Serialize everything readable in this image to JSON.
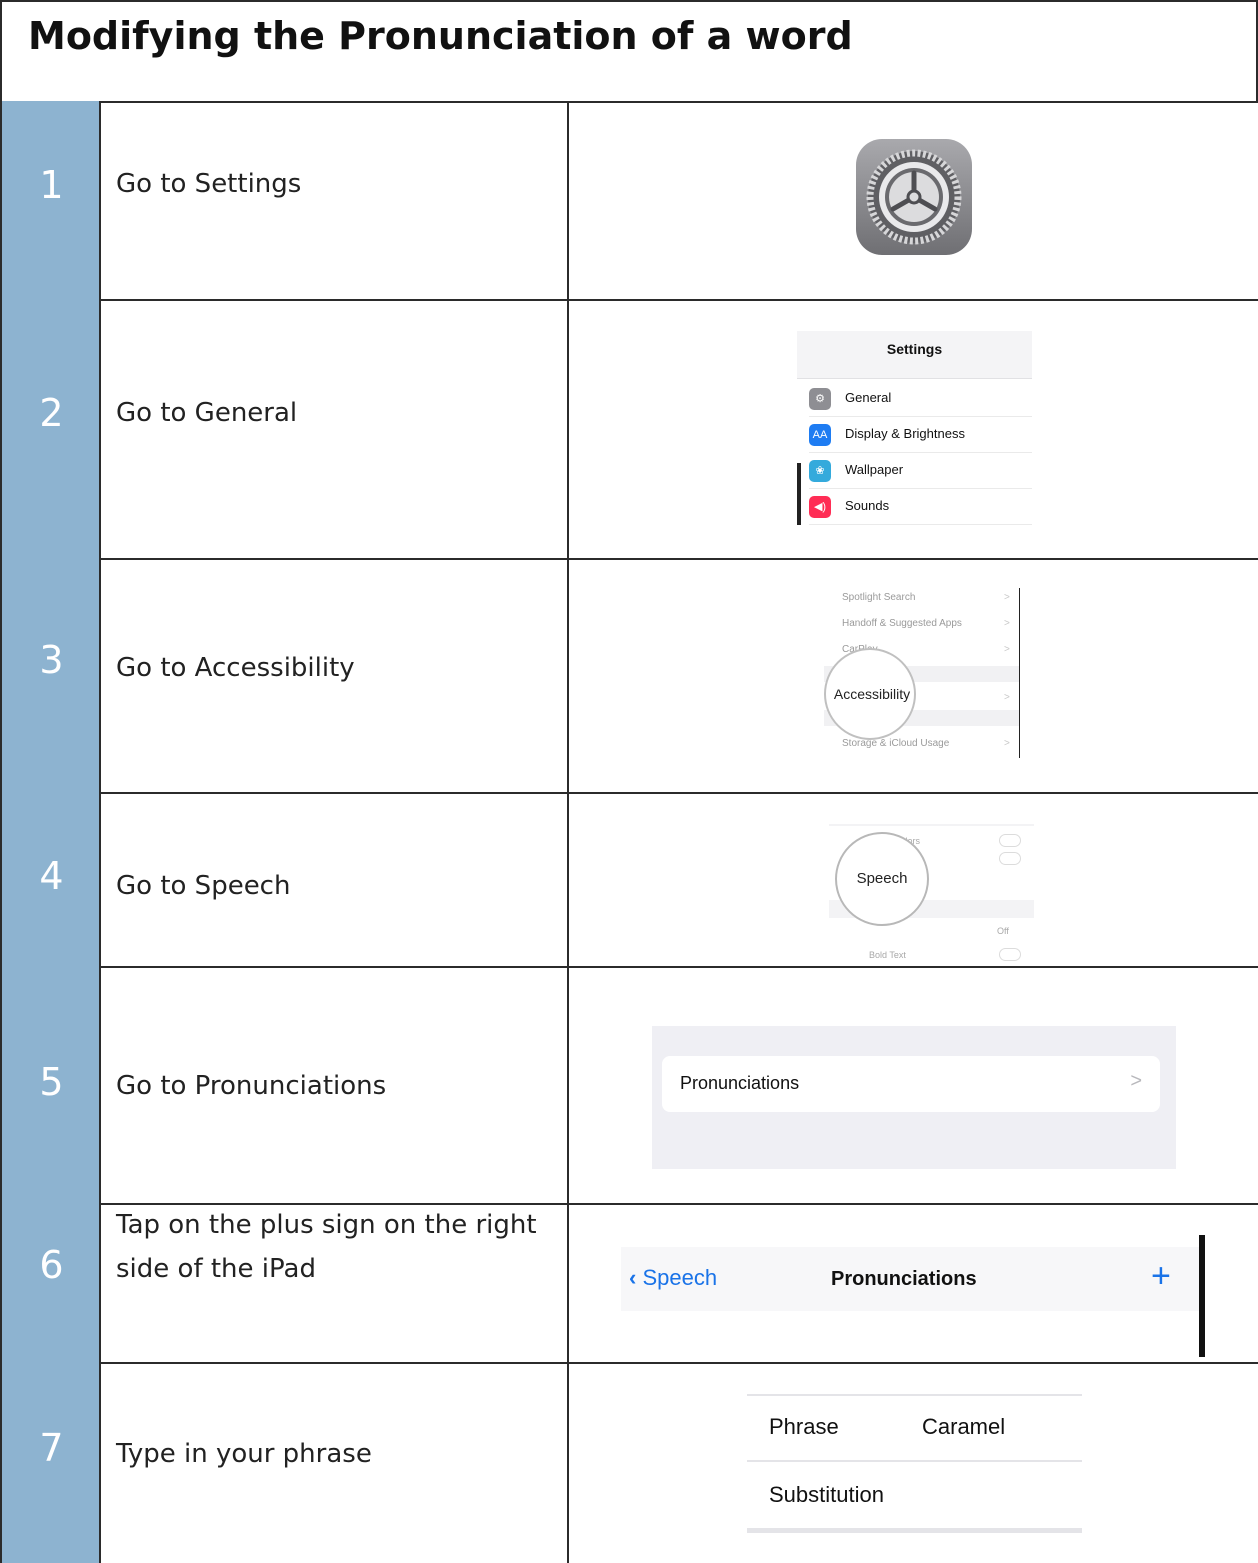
{
  "document": {
    "title": "Modifying the Pronunciation of a word"
  },
  "steps": [
    {
      "number": "1",
      "instruction": "Go to Settings"
    },
    {
      "number": "2",
      "instruction": "Go to General"
    },
    {
      "number": "3",
      "instruction": "Go to Accessibility"
    },
    {
      "number": "4",
      "instruction": "Go to Speech"
    },
    {
      "number": "5",
      "instruction": "Go to Pronunciations"
    },
    {
      "number": "6",
      "instruction": "Tap on the plus sign on the right side of the iPad"
    },
    {
      "number": "7",
      "instruction": "Type in your phrase"
    }
  ],
  "screens": {
    "settings_list": {
      "title": "Settings",
      "items": [
        "General",
        "Display & Brightness",
        "Wallpaper",
        "Sounds"
      ],
      "icon_colors": [
        "#8e8e93",
        "#1e7cf2",
        "#34aadc",
        "#ff2d55"
      ]
    },
    "accessibility_list": {
      "items": [
        "Spotlight Search",
        "Handoff & Suggested Apps",
        "CarPlay",
        "Storage & iCloud Usage"
      ],
      "magnified": "Accessibility",
      "chevron": ">"
    },
    "speech_list": {
      "items": [
        "Invert Colors",
        "Bold Text"
      ],
      "value": "Off",
      "magnified": "Speech"
    },
    "pronunciations_row": {
      "label": "Pronunciations",
      "chevron": ">"
    },
    "nav_bar": {
      "back_label": "Speech",
      "title": "Pronunciations",
      "add_label": "+",
      "accent_color": "#1a73e8"
    },
    "phrase_form": {
      "phrase_label": "Phrase",
      "phrase_value": "Caramel",
      "substitution_label": "Substitution"
    }
  }
}
